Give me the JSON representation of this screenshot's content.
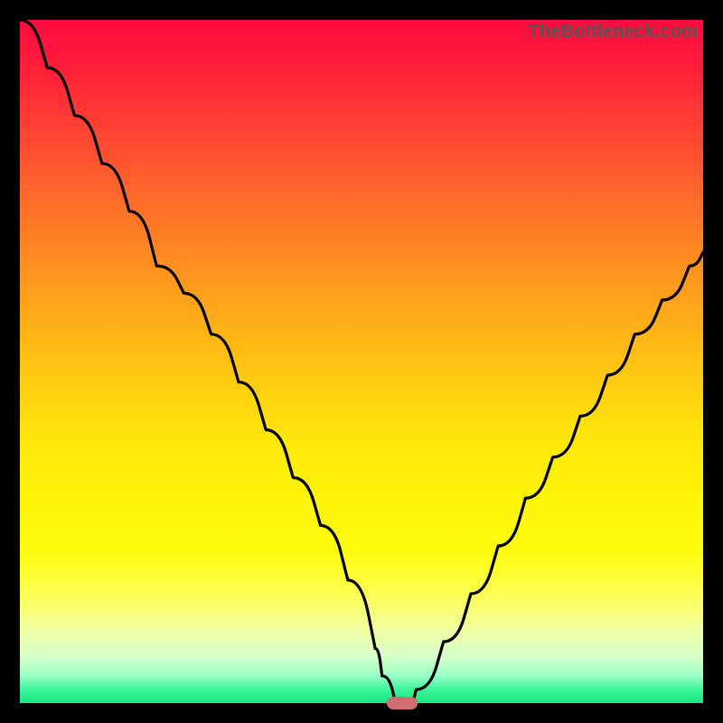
{
  "watermark": "TheBottleneck.com",
  "colors": {
    "frame": "#000000",
    "curve": "#000000",
    "marker": "#cf6e6e",
    "gradient_stops": [
      "#ff0b3e",
      "#ff3a35",
      "#ff7a26",
      "#ffb416",
      "#ffe80a",
      "#fffc10",
      "#f2ff9e",
      "#9affc6",
      "#18e57e"
    ]
  },
  "chart_data": {
    "type": "line",
    "title": "",
    "xlabel": "",
    "ylabel": "",
    "xlim": [
      0,
      100
    ],
    "ylim": [
      0,
      100
    ],
    "grid": false,
    "series": [
      {
        "name": "curve",
        "x": [
          0,
          4,
          8,
          12,
          16,
          20,
          24,
          28,
          32,
          36,
          40,
          44,
          48,
          52,
          53,
          55,
          57,
          58,
          62,
          66,
          70,
          74,
          78,
          82,
          86,
          90,
          94,
          98,
          100
        ],
        "y": [
          100,
          93,
          86,
          79,
          72,
          64,
          60,
          54,
          47,
          40,
          33,
          26,
          18,
          8,
          4,
          0,
          0,
          2,
          9,
          16,
          23,
          30,
          36,
          42,
          48,
          54,
          59,
          64,
          66
        ]
      }
    ],
    "marker": {
      "x": 56,
      "y": 0,
      "shape": "pill"
    }
  }
}
